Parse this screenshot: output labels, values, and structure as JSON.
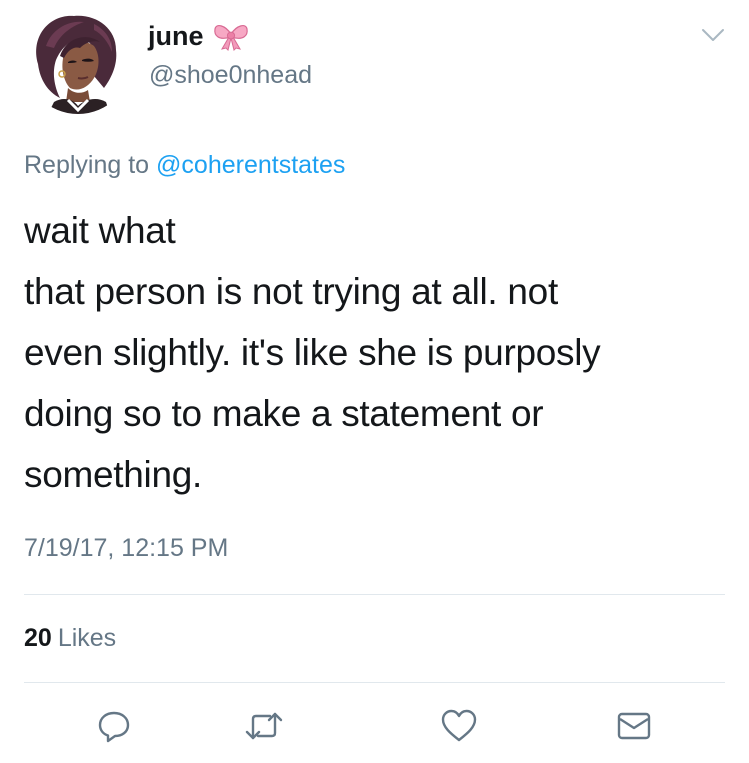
{
  "user": {
    "display_name": "june",
    "handle": "@shoe0nhead",
    "name_emoji_icon": "ribbon-bow-icon"
  },
  "reply_context": {
    "prefix": "Replying to",
    "mention": "@coherentstates"
  },
  "tweet": {
    "lines": [
      "wait what",
      "that person is not trying at all. not",
      "even slightly. it's like she is purposly",
      "doing so to make a statement or",
      "something."
    ],
    "timestamp": "7/19/17, 12:15 PM"
  },
  "stats": {
    "likes_count": "20",
    "likes_label": "Likes"
  },
  "actions": {
    "reply_icon": "reply-icon",
    "retweet_icon": "retweet-icon",
    "like_icon": "heart-icon",
    "dm_icon": "envelope-icon"
  },
  "colors": {
    "text_primary": "#14171a",
    "text_secondary": "#657786",
    "link": "#1da1f2",
    "divider": "#e1e8ed",
    "icon": "#657786"
  }
}
